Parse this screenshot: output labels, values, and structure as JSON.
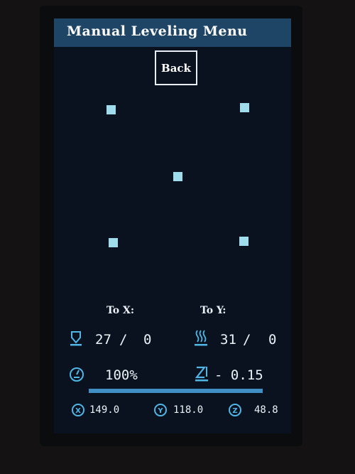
{
  "header": {
    "title": "Manual Leveling Menu"
  },
  "back_button": {
    "label": "Back"
  },
  "leveling_points": [
    "front-left",
    "front-right",
    "center",
    "back-left",
    "back-right"
  ],
  "targets": {
    "x_label": "To X:",
    "y_label": "To Y:"
  },
  "temperatures": {
    "nozzle": {
      "current": "27",
      "separator": "/",
      "target": "0"
    },
    "bed": {
      "current": "31",
      "separator": "/",
      "target": "0"
    }
  },
  "feedrate": {
    "value": "100%"
  },
  "z_offset": {
    "value": "- 0.15"
  },
  "progress": {
    "percent": 100
  },
  "coordinates": {
    "x": {
      "axis": "X",
      "value": "149.0"
    },
    "y": {
      "axis": "Y",
      "value": "118.0"
    },
    "z": {
      "axis": "Z",
      "value": "48.8"
    }
  },
  "colors": {
    "title_bar": "#1e4466",
    "accent": "#9fdcec",
    "screen": "#0a1220",
    "progress": "#3f8fc4"
  }
}
